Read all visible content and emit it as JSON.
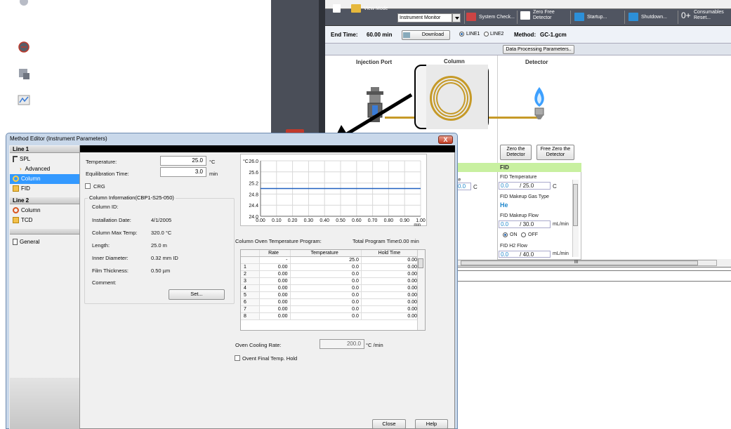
{
  "background_app": {
    "left_panel": {
      "start_label": "Start\nSingle Run",
      "stop_label": "Stop",
      "snapshot_label": "Snapshot",
      "data_analysis_label": "Data Analysis"
    },
    "toolbar": {
      "view_mode_label": "View Mode",
      "view_mode_value": "Instrument Monitor",
      "system_check": "System Check...",
      "zero_free_detector": "Zero Free\nDetector",
      "startup": "Startup...",
      "shutdown": "Shutdown...",
      "consumables_reset": "Consumables\nReset..."
    },
    "run_bar": {
      "end_time_label": "End Time:",
      "end_time_value": "60.00  min",
      "download": "Download",
      "line1": "LINE1",
      "line2": "LINE2",
      "method_label": "Method:",
      "method_value": "GC-1.gcm"
    },
    "data_processing_button": "Data Processing Parameters..",
    "diagram": {
      "injection_port": "Injection Port",
      "column": "Column",
      "detector": "Detector",
      "zero_detector": "Zero the\nDetector",
      "free_zero_detector": "Free Zero the\nDetector"
    },
    "fid_panel": {
      "header": "FID",
      "partial_label": "re",
      "partial_value": "0.0",
      "partial_unit": "C",
      "temperature_label": "FID Temperature",
      "temperature_value": "0.0",
      "temperature_set": "/ 25.0",
      "temperature_unit": "C",
      "makeup_gas_label": "FID Makeup Gas Type",
      "makeup_gas_value": "He",
      "makeup_flow_label": "FID Makeup Flow",
      "makeup_flow_value": "0.0",
      "makeup_flow_set": "/ 30.0",
      "makeup_flow_unit": "mL/min",
      "on": "ON",
      "off": "OFF",
      "h2_flow_label": "FID H2 Flow",
      "h2_flow_value": "0.0",
      "h2_flow_set": "/ 40.0",
      "h2_flow_unit": "mL/min",
      "scroll_grip": "III"
    }
  },
  "dialog": {
    "title": "Method Editor (Instrument Parameters)",
    "close_x": "X",
    "sidebar": {
      "line1_header": "Line 1",
      "line2_header": "Line 2",
      "items": [
        {
          "label": "SPL"
        },
        {
          "label": "Advanced"
        },
        {
          "label": "Column"
        },
        {
          "label": "FID"
        },
        {
          "label": "Column"
        },
        {
          "label": "TCD"
        },
        {
          "label": "General"
        }
      ]
    },
    "form": {
      "temperature_label": "Temperature:",
      "temperature_value": "25.0",
      "temperature_unit": "°C",
      "equilibration_label": "Equilibration Time:",
      "equilibration_value": "3.0",
      "equilibration_unit": "min",
      "crg_label": "CRG",
      "column_info_legend": "Column  Information(CBP1-S25-050)",
      "column_id_label": "Column ID:",
      "install_date_label": "Installation Date:",
      "install_date_value": "4/1/2005",
      "max_temp_label": "Column Max Temp:",
      "max_temp_value": "320.0 °C",
      "length_label": "Length:",
      "length_value": "25.0 m",
      "inner_diameter_label": "Inner Diameter:",
      "inner_diameter_value": "0.32 mm ID",
      "film_thickness_label": "Film Thickness:",
      "film_thickness_value": "0.50 µm",
      "comment_label": "Comment:",
      "set_button": "Set...",
      "oven_program_label": "Column Oven Temperature Program:",
      "total_time_label": "Total Program Time:",
      "total_time_value": "0.00  min",
      "oven_cooling_label": "Oven Cooling Rate:",
      "oven_cooling_value": "200.0",
      "oven_cooling_unit": "°C /min",
      "final_hold_label": "Ovent Final Temp. Hold",
      "close_button": "Close",
      "help_button": "Help"
    },
    "program_table": {
      "headers": [
        "",
        "Rate",
        "Temperature",
        "Hold Time"
      ],
      "rows": [
        [
          "",
          "-",
          "25.0",
          "0.00"
        ],
        [
          "1",
          "0.00",
          "0.0",
          "0.00"
        ],
        [
          "2",
          "0.00",
          "0.0",
          "0.00"
        ],
        [
          "3",
          "0.00",
          "0.0",
          "0.00"
        ],
        [
          "4",
          "0.00",
          "0.0",
          "0.00"
        ],
        [
          "5",
          "0.00",
          "0.0",
          "0.00"
        ],
        [
          "6",
          "0.00",
          "0.0",
          "0.00"
        ],
        [
          "7",
          "0.00",
          "0.0",
          "0.00"
        ],
        [
          "8",
          "0.00",
          "0.0",
          "0.00"
        ]
      ]
    }
  },
  "chart_data": {
    "type": "line",
    "ylabel": "°C",
    "xlabel": "min",
    "x_ticks": [
      "0.00",
      "0.10",
      "0.20",
      "0.30",
      "0.40",
      "0.50",
      "0.60",
      "0.70",
      "0.80",
      "0.90",
      "1.00"
    ],
    "y_ticks": [
      "24.0",
      "24.4",
      "24.8",
      "25.2",
      "25.6",
      "26.0"
    ],
    "xlim": [
      0,
      1
    ],
    "ylim": [
      24.0,
      26.0
    ],
    "grid": true,
    "series": [
      {
        "x": [
          0.0,
          1.0
        ],
        "y": [
          25.0,
          25.0
        ]
      }
    ]
  }
}
